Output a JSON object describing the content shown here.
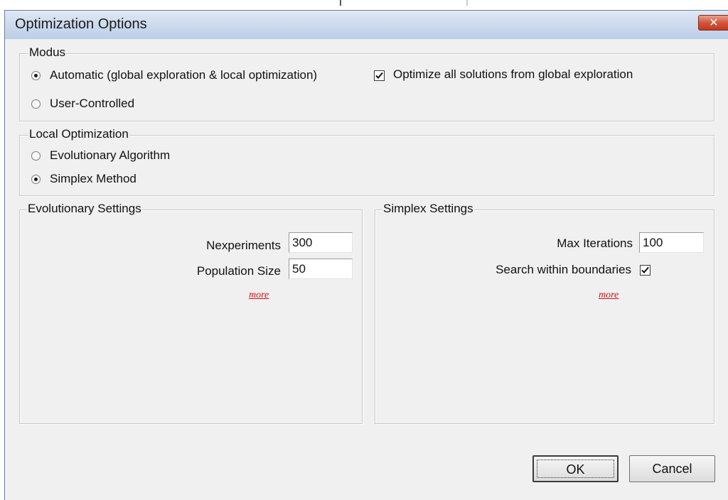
{
  "window": {
    "title": "Optimization Options",
    "close_icon": "close-icon"
  },
  "modus": {
    "legend": "Modus",
    "option_automatic": "Automatic (global exploration & local optimization)",
    "option_user_controlled": "User-Controlled",
    "selected": "automatic",
    "optimize_all_label": "Optimize all solutions from global exploration",
    "optimize_all_checked": true
  },
  "local_optimization": {
    "legend": "Local Optimization",
    "option_evolutionary": "Evolutionary Algorithm",
    "option_simplex": "Simplex Method",
    "selected": "simplex"
  },
  "evolutionary_settings": {
    "legend": "Evolutionary Settings",
    "nexperiments_label": "Nexperiments",
    "nexperiments_value": "300",
    "population_size_label": "Population Size",
    "population_size_value": "50",
    "more_link": "more"
  },
  "simplex_settings": {
    "legend": "Simplex Settings",
    "max_iterations_label": "Max Iterations",
    "max_iterations_value": "100",
    "search_within_boundaries_label": "Search within boundaries",
    "search_within_boundaries_checked": true,
    "more_link": "more"
  },
  "buttons": {
    "ok": "OK",
    "cancel": "Cancel"
  }
}
